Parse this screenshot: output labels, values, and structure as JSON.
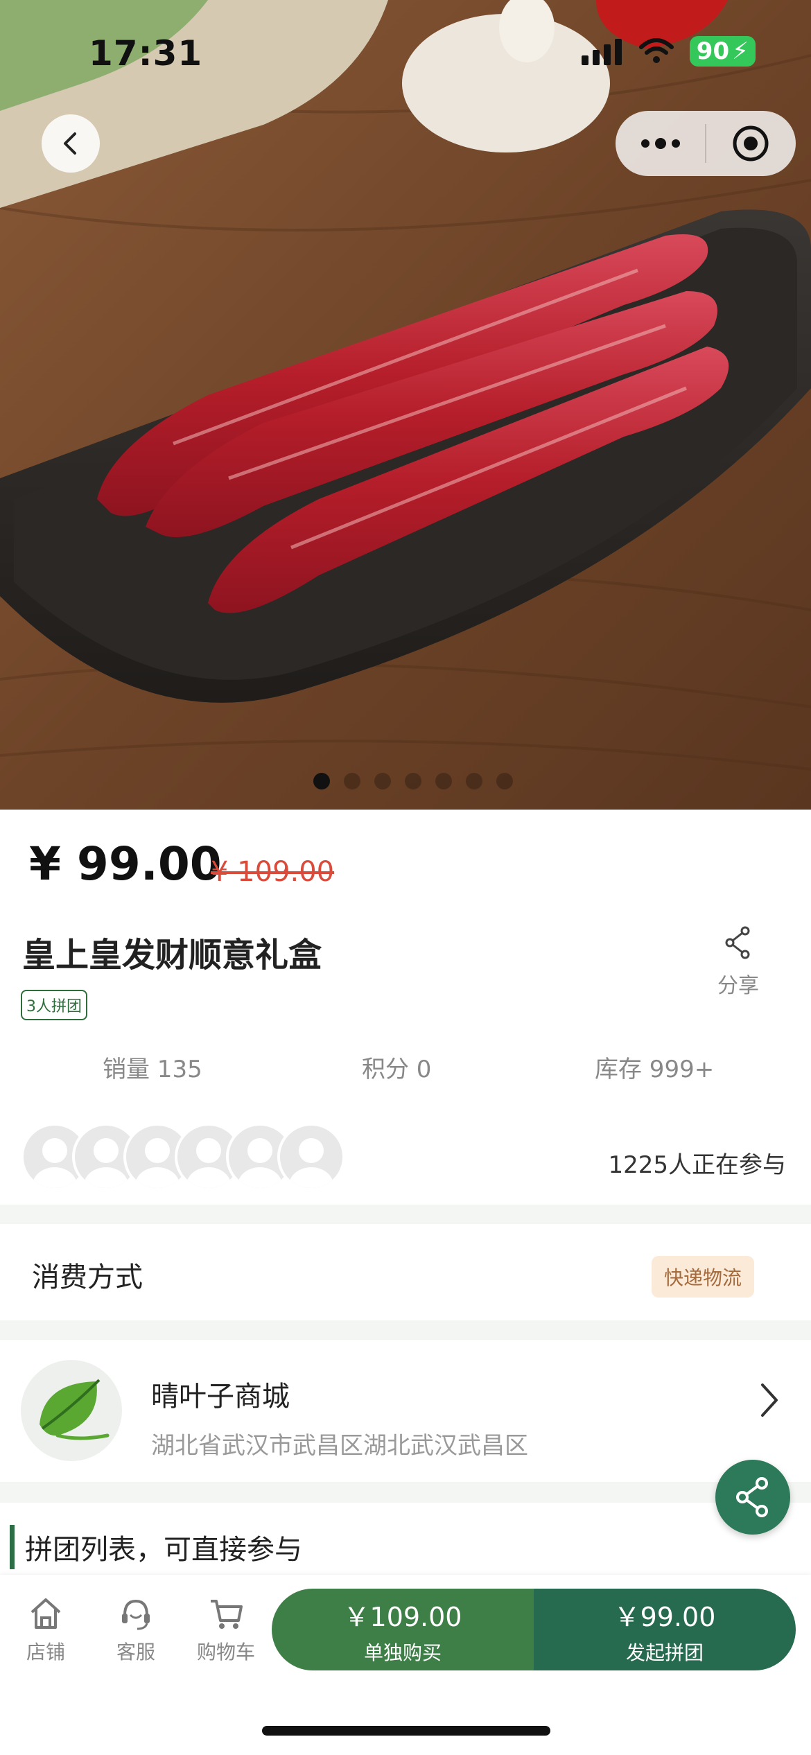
{
  "status_bar": {
    "time": "17:31",
    "battery": "90"
  },
  "product": {
    "price": "¥ 99.00",
    "original_price": "¥ 109.00",
    "title": "皇上皇发财顺意礼盒",
    "group_tag": "3人拼团",
    "share_label": "分享",
    "stats": {
      "sales": "销量 135",
      "points": "积分 0",
      "stock": "库存 999+"
    },
    "participants": "1225人正在参与"
  },
  "consume": {
    "label": "消费方式",
    "tag": "快递物流"
  },
  "shop": {
    "name": "晴叶子商城",
    "address": "湖北省武汉市武昌区湖北武汉武昌区"
  },
  "group_list": {
    "title": "拼团列表，可直接参与"
  },
  "bottom_nav": {
    "items": [
      {
        "label": "店铺",
        "icon": "home-icon"
      },
      {
        "label": "客服",
        "icon": "headset-icon"
      },
      {
        "label": "购物车",
        "icon": "cart-icon"
      }
    ],
    "buy_single": {
      "price": "￥109.00",
      "label": "单独购买"
    },
    "buy_group": {
      "price": "￥99.00",
      "label": "发起拼团"
    }
  },
  "colors": {
    "primary_green": "#2d7a5a",
    "price_red": "#d94b3b"
  }
}
